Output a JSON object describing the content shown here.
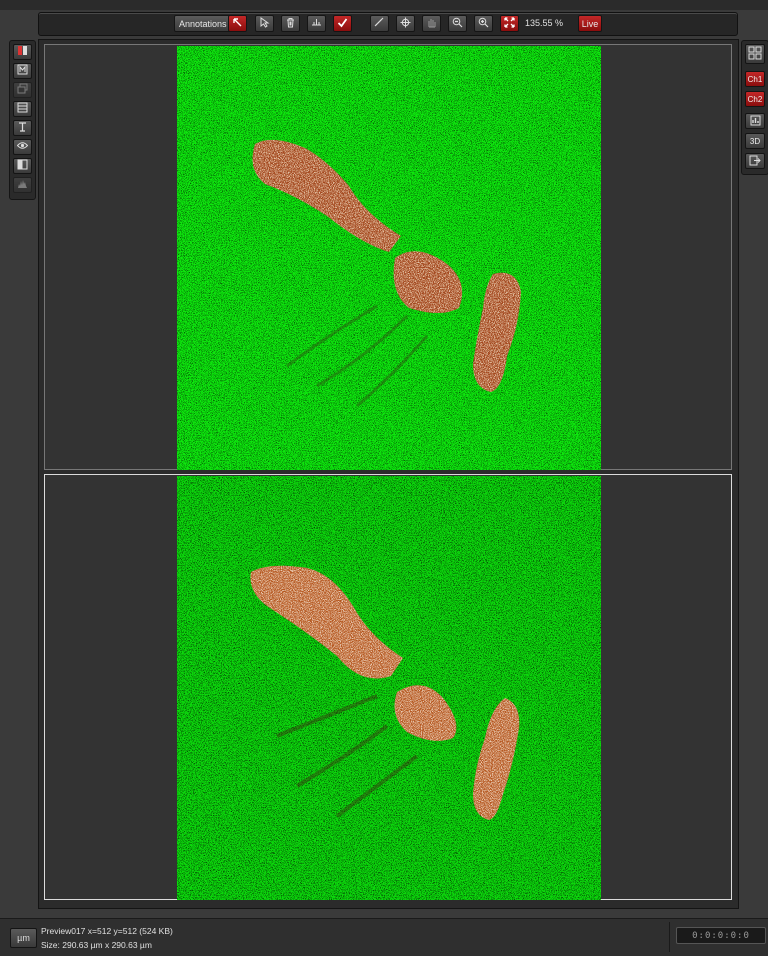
{
  "toolbar": {
    "annotations_label": "Annotations",
    "zoom_level": "135.55 %",
    "live_label": "Live",
    "icons": [
      "draw-arrow-icon",
      "select-arrow-icon",
      "trash-icon",
      "baseline-icon",
      "check-icon",
      "ruler-icon",
      "crosshair-icon",
      "hand-icon",
      "zoom-out-icon",
      "zoom-in-icon",
      "fit-window-icon"
    ]
  },
  "sidebar_left": {
    "icons": [
      "color-channel-icon",
      "channel-settings-icon",
      "stack-icon",
      "layers-icon",
      "text-tool-icon",
      "eye-icon",
      "contrast-icon",
      "histogram-icon"
    ]
  },
  "sidebar_right": {
    "layout_icon": "grid-layout-icon",
    "ch1_label": "Ch1",
    "ch2_label": "Ch2",
    "view3d_label": "3D",
    "icons": [
      "grid-layout-icon",
      "chart-icon",
      "export-icon"
    ]
  },
  "status": {
    "unit_label": "µm",
    "info_line1": "Preview017 x=512 y=512  (524 KB)",
    "info_line2": "Size: 290.63 µm x 290.63 µm",
    "timer": "0:0:0:0:0"
  },
  "colors": {
    "background": "#0df000",
    "signal": "#c0501e",
    "accent_red": "#b01a1a"
  }
}
